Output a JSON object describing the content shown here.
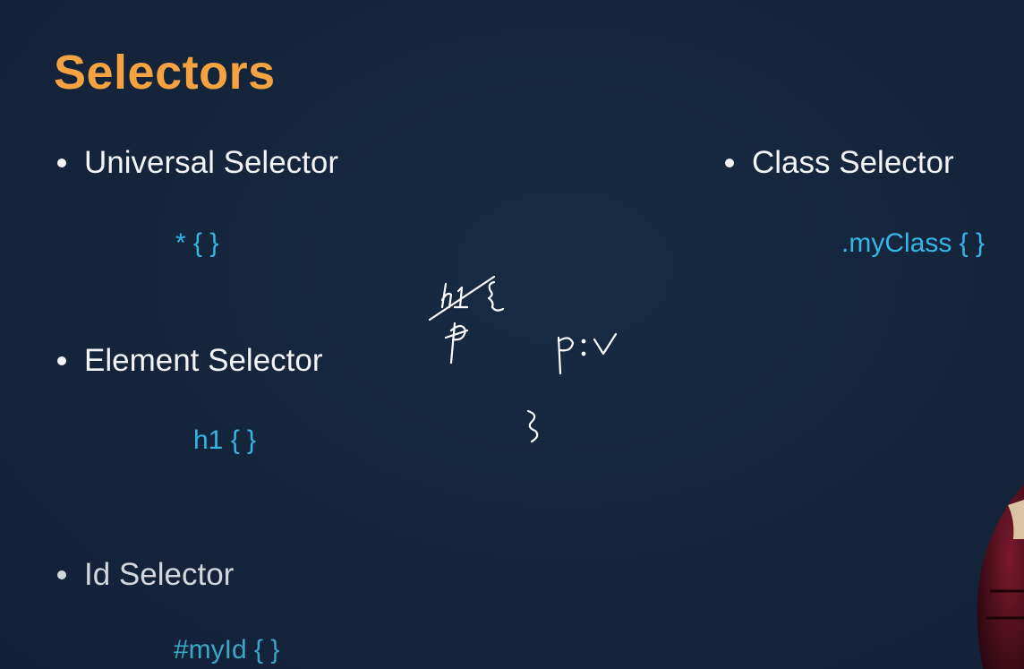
{
  "slide": {
    "title": "Selectors",
    "colors": {
      "background": "#14243a",
      "title": "#f4a340",
      "bullet_text": "#f2f4f7",
      "code": "#35b6e6"
    },
    "items": [
      {
        "label": "Universal Selector",
        "code": "* { }"
      },
      {
        "label": "Element Selector",
        "code": "h1 { }"
      },
      {
        "label": "Id Selector",
        "code": "#myId { }"
      },
      {
        "label": "Class Selector",
        "code": ".myClass { }"
      }
    ],
    "annotations": {
      "icon": "handwritten-scribble",
      "description_shown_as_drawing": true
    }
  }
}
